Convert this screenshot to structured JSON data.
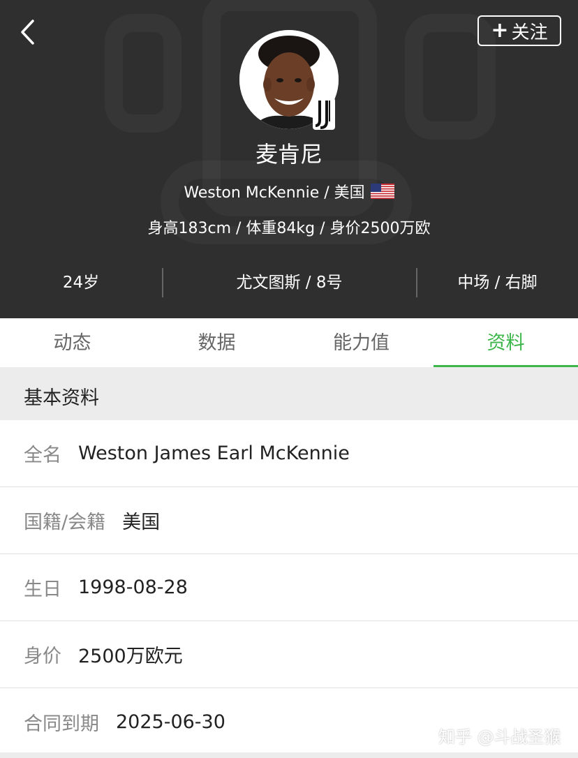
{
  "header": {
    "follow_label": "关注",
    "player_name": "麦肯尼",
    "subtitle": "Weston McKennie / 美国",
    "physical": "身高183cm / 体重84kg / 身价2500万欧",
    "stats": [
      "24岁",
      "尤文图斯 / 8号",
      "中场 / 右脚"
    ]
  },
  "tabs": [
    {
      "label": "动态"
    },
    {
      "label": "数据"
    },
    {
      "label": "能力值"
    },
    {
      "label": "资料"
    }
  ],
  "active_tab": "资料",
  "section_title": "基本资料",
  "rows": [
    {
      "label": "全名",
      "value": "Weston James Earl McKennie"
    },
    {
      "label": "国籍/会籍",
      "value": "美国"
    },
    {
      "label": "生日",
      "value": "1998-08-28"
    },
    {
      "label": "身价",
      "value": "2500万欧元"
    },
    {
      "label": "合同到期",
      "value": "2025-06-30"
    }
  ],
  "watermark": "知乎 @斗战圣猴",
  "colors": {
    "header_bg": "#2f2f2f",
    "accent": "#3cb64a",
    "section_bg": "#ececec"
  },
  "icons": {
    "back": "chevron-left-icon",
    "follow": "plus-icon",
    "flag": "us-flag-icon",
    "club": "juventus-logo"
  }
}
